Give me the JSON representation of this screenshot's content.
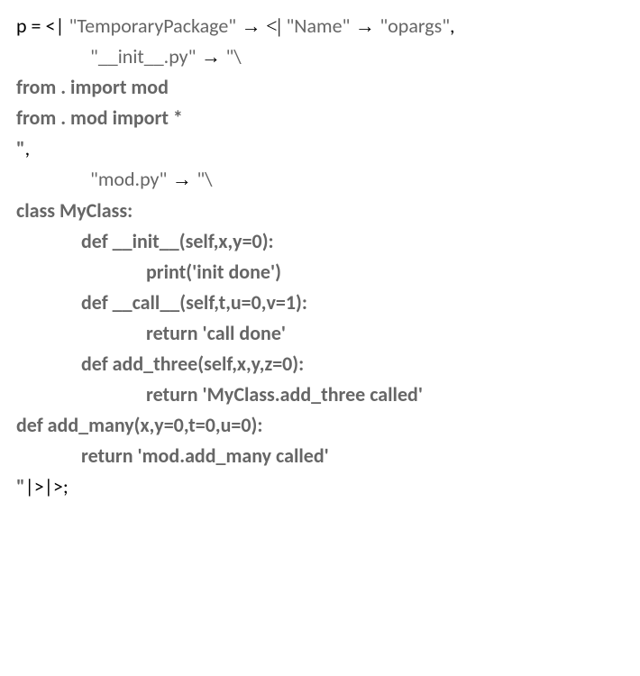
{
  "line1": {
    "open": "p = <| ",
    "key1": "\"TemporaryPackage\"",
    "arrow1": " → <| ",
    "key2": "\"Name\"",
    "arrow2": " → ",
    "val2": "\"opargs\"",
    "end": ","
  },
  "line2": {
    "key": "\"__init__.py\"",
    "arrow": " → ",
    "val": "\"\\",
    "end": ""
  },
  "line3": "from . import mod",
  "line4": "from . mod import *",
  "line5": "\"",
  "line5b": ",",
  "line6": {
    "key": "\"mod.py\"",
    "arrow": " → ",
    "val": "\"\\",
    "end": ""
  },
  "line7": "class MyClass:",
  "line8": "def __init__(self,x,y=0):",
  "line9": "print('init done')",
  "line10": "def __call__(self,t,u=0,v=1):",
  "line11": "return 'call done'",
  "line12": "def add_three(self,x,y,z=0):",
  "line13": "return 'MyClass.add_three called'",
  "line14": "def add_many(x,y=0,t=0,u=0):",
  "line15": "return 'mod.add_many called'",
  "line16a": "\"",
  "line16b": "|>|>;"
}
